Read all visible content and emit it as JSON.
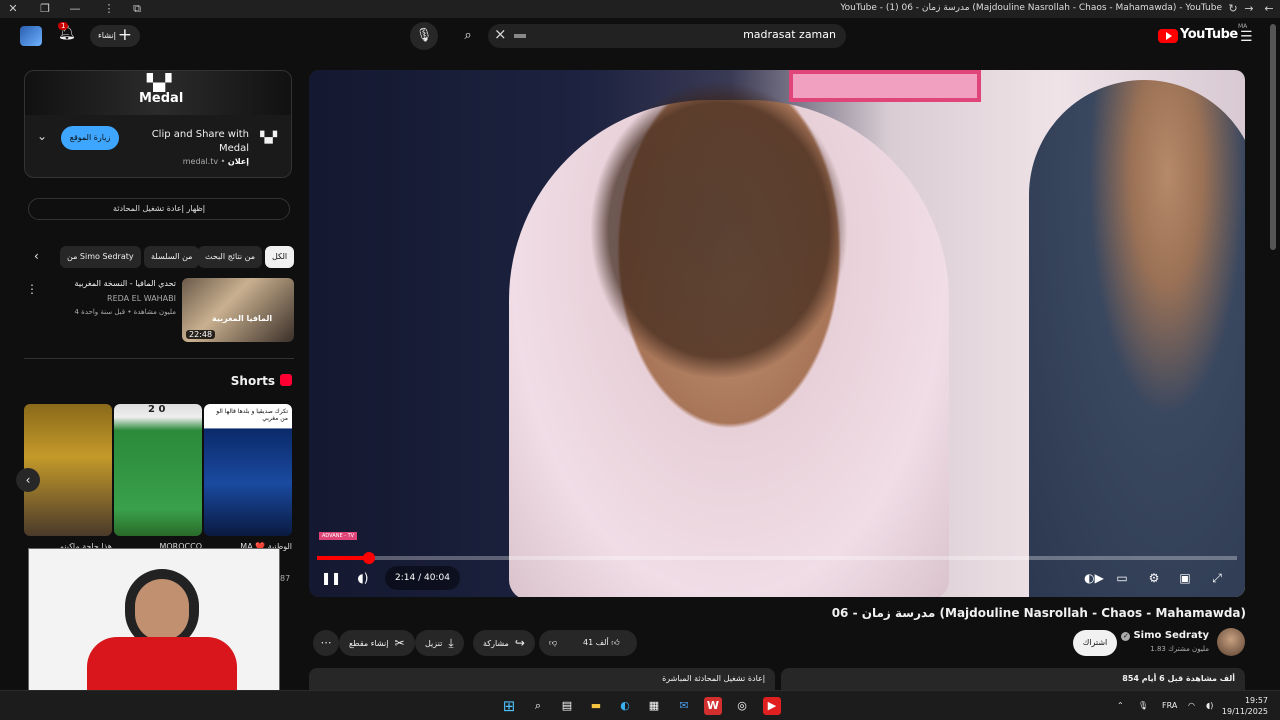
{
  "window": {
    "title": "YouTube - (1) 06 - مدرسة زمان (Majdouline Nasrollah - Chaos - Mahamawda) - YouTube"
  },
  "header": {
    "search_query": "madrasat zaman",
    "create_label": "إنشاء",
    "notif_count": "1",
    "logo_text": "YouTube",
    "logo_cc": "MA"
  },
  "ad": {
    "brand": "Medal",
    "title_line1": "Clip and Share with",
    "title_line2": "Medal",
    "source": "medal.tv",
    "sponsored": "إعلان",
    "visit_label": "زيارة الموقع"
  },
  "sidebar": {
    "replay_label": "إظهار إعادة تشغيل المحادثة",
    "chips": [
      {
        "label": "الكل"
      },
      {
        "label": "من نتائج البحث"
      },
      {
        "label": "من السلسلة"
      },
      {
        "label": "من Simo Sedraty"
      }
    ],
    "video": {
      "title": "تحدي المافيا - النسخة المغربية",
      "channel": "REDA EL WAHABI",
      "meta": "4 مليون مشاهدة • قبل سنة واحدة",
      "duration": "22:48",
      "thumb_text": "المافيا المغربية"
    },
    "shorts_heading": "Shorts",
    "shorts": [
      {
        "caption": "هذا حاجة ماكينو"
      },
      {
        "caption": "MOROCCO",
        "score": "2 0"
      },
      {
        "caption": "MA ❤️ الوطنية",
        "top_text": "تكرك صديقيا و بلدها قالها الو من مغربي"
      }
    ],
    "shorts_side_count": "87"
  },
  "player": {
    "current_time": "2:14",
    "duration": "40:04",
    "progress_fraction": 0.056,
    "tag_text": "ADVANE - TV"
  },
  "video": {
    "title": "مدرسة زمان - 06 (Majdouline Nasrollah - Chaos - Mahamawda)",
    "channel": "Simo Sedraty",
    "subscribers": "1.83 مليون مشترك",
    "subscribe_label": "اشتراك",
    "likes": "41 ألف",
    "share_label": "مشاركة",
    "download_label": "تنزيل",
    "clip_label": "إنشاء مقطع",
    "views_date": "854 ألف مشاهدة قبل 6 أيام",
    "live_replay_label": "إعادة تشغيل المحادثة المباشرة"
  },
  "taskbar": {
    "lang": "FRA",
    "time": "19:57",
    "date": "19/11/2025"
  }
}
